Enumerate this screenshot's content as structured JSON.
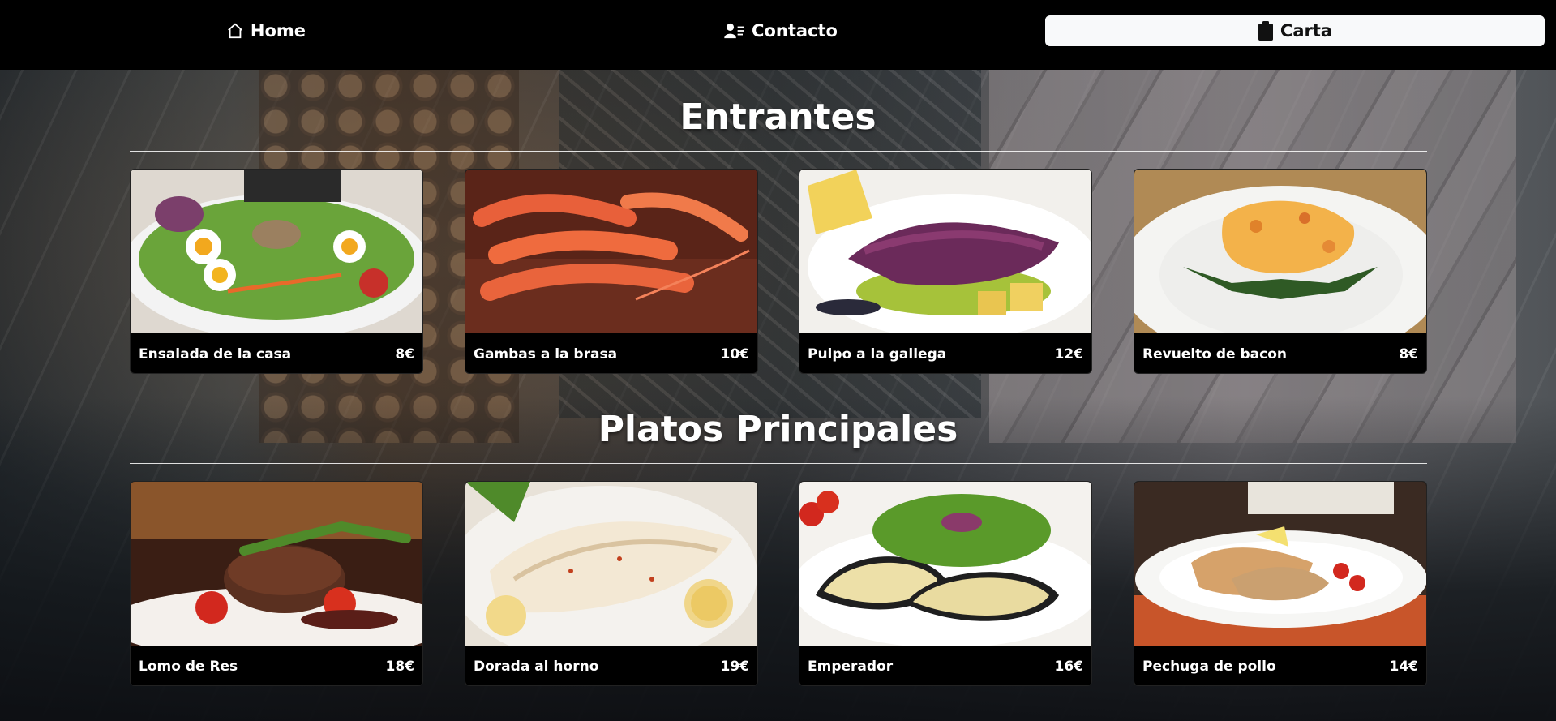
{
  "nav": {
    "home_label": "Home",
    "contacto_label": "Contacto",
    "carta_label": "Carta"
  },
  "sections": [
    {
      "title": "Entrantes",
      "items": [
        {
          "name": "Ensalada de la casa",
          "price": "8€"
        },
        {
          "name": "Gambas a la brasa",
          "price": "10€"
        },
        {
          "name": "Pulpo a la gallega",
          "price": "12€"
        },
        {
          "name": "Revuelto de bacon",
          "price": "8€"
        }
      ]
    },
    {
      "title": "Platos Principales",
      "items": [
        {
          "name": "Lomo de Res",
          "price": "18€"
        },
        {
          "name": "Dorada al horno",
          "price": "19€"
        },
        {
          "name": "Emperador",
          "price": "16€"
        },
        {
          "name": "Pechuga de pollo",
          "price": "14€"
        }
      ]
    }
  ],
  "colors": {
    "navbar_bg": "#000000",
    "active_tab_bg": "#f8f9fa",
    "card_bg": "#000000"
  }
}
